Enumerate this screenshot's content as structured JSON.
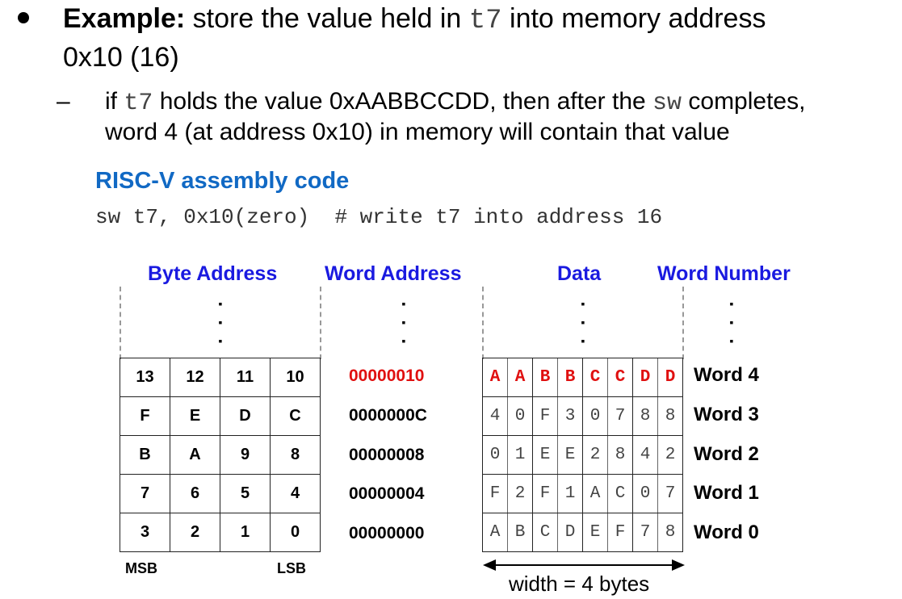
{
  "bullet": {
    "example_bold": "Example:",
    "line1_a": " store the value held in ",
    "line1_reg": "t7",
    "line1_b": " into memory address",
    "line2": "0x10 (16)"
  },
  "sub": {
    "dash": "–",
    "a": "if ",
    "reg": "t7",
    "b": " holds the value 0xAABBCCDD, then after the ",
    "instr": "sw",
    "c": " completes,",
    "line2": "word 4 (at address 0x10) in memory will contain that value"
  },
  "code": {
    "title": "RISC-V assembly code",
    "line": "sw t7, 0x10(zero)  # write t7 into address 16"
  },
  "diagram": {
    "headers": {
      "byte_address": "Byte Address",
      "word_address": "Word Address",
      "data": "Data",
      "word_number": "Word Number"
    },
    "byte_rows": [
      [
        "13",
        "12",
        "11",
        "10"
      ],
      [
        "F",
        "E",
        "D",
        "C"
      ],
      [
        "B",
        "A",
        "9",
        "8"
      ],
      [
        "7",
        "6",
        "5",
        "4"
      ],
      [
        "3",
        "2",
        "1",
        "0"
      ]
    ],
    "word_addresses": [
      "00000010",
      "0000000C",
      "00000008",
      "00000004",
      "00000000"
    ],
    "data_rows": [
      [
        [
          "A",
          "A"
        ],
        [
          "B",
          "B"
        ],
        [
          "C",
          "C"
        ],
        [
          "D",
          "D"
        ]
      ],
      [
        [
          "4",
          "0"
        ],
        [
          "F",
          "3"
        ],
        [
          "0",
          "7"
        ],
        [
          "8",
          "8"
        ]
      ],
      [
        [
          "0",
          "1"
        ],
        [
          "E",
          "E"
        ],
        [
          "2",
          "8"
        ],
        [
          "4",
          "2"
        ]
      ],
      [
        [
          "F",
          "2"
        ],
        [
          "F",
          "1"
        ],
        [
          "A",
          "C"
        ],
        [
          "0",
          "7"
        ]
      ],
      [
        [
          "A",
          "B"
        ],
        [
          "C",
          "D"
        ],
        [
          "E",
          "F"
        ],
        [
          "7",
          "8"
        ]
      ]
    ],
    "word_numbers": [
      "Word 4",
      "Word 3",
      "Word 2",
      "Word 1",
      "Word 0"
    ],
    "highlight_row": 0,
    "msb": "MSB",
    "lsb": "LSB",
    "width_label": "width = 4 bytes",
    "colors": {
      "header_blue": "#1a1ae0",
      "highlight_red": "#e01010",
      "code_title_blue": "#1169c4"
    }
  }
}
